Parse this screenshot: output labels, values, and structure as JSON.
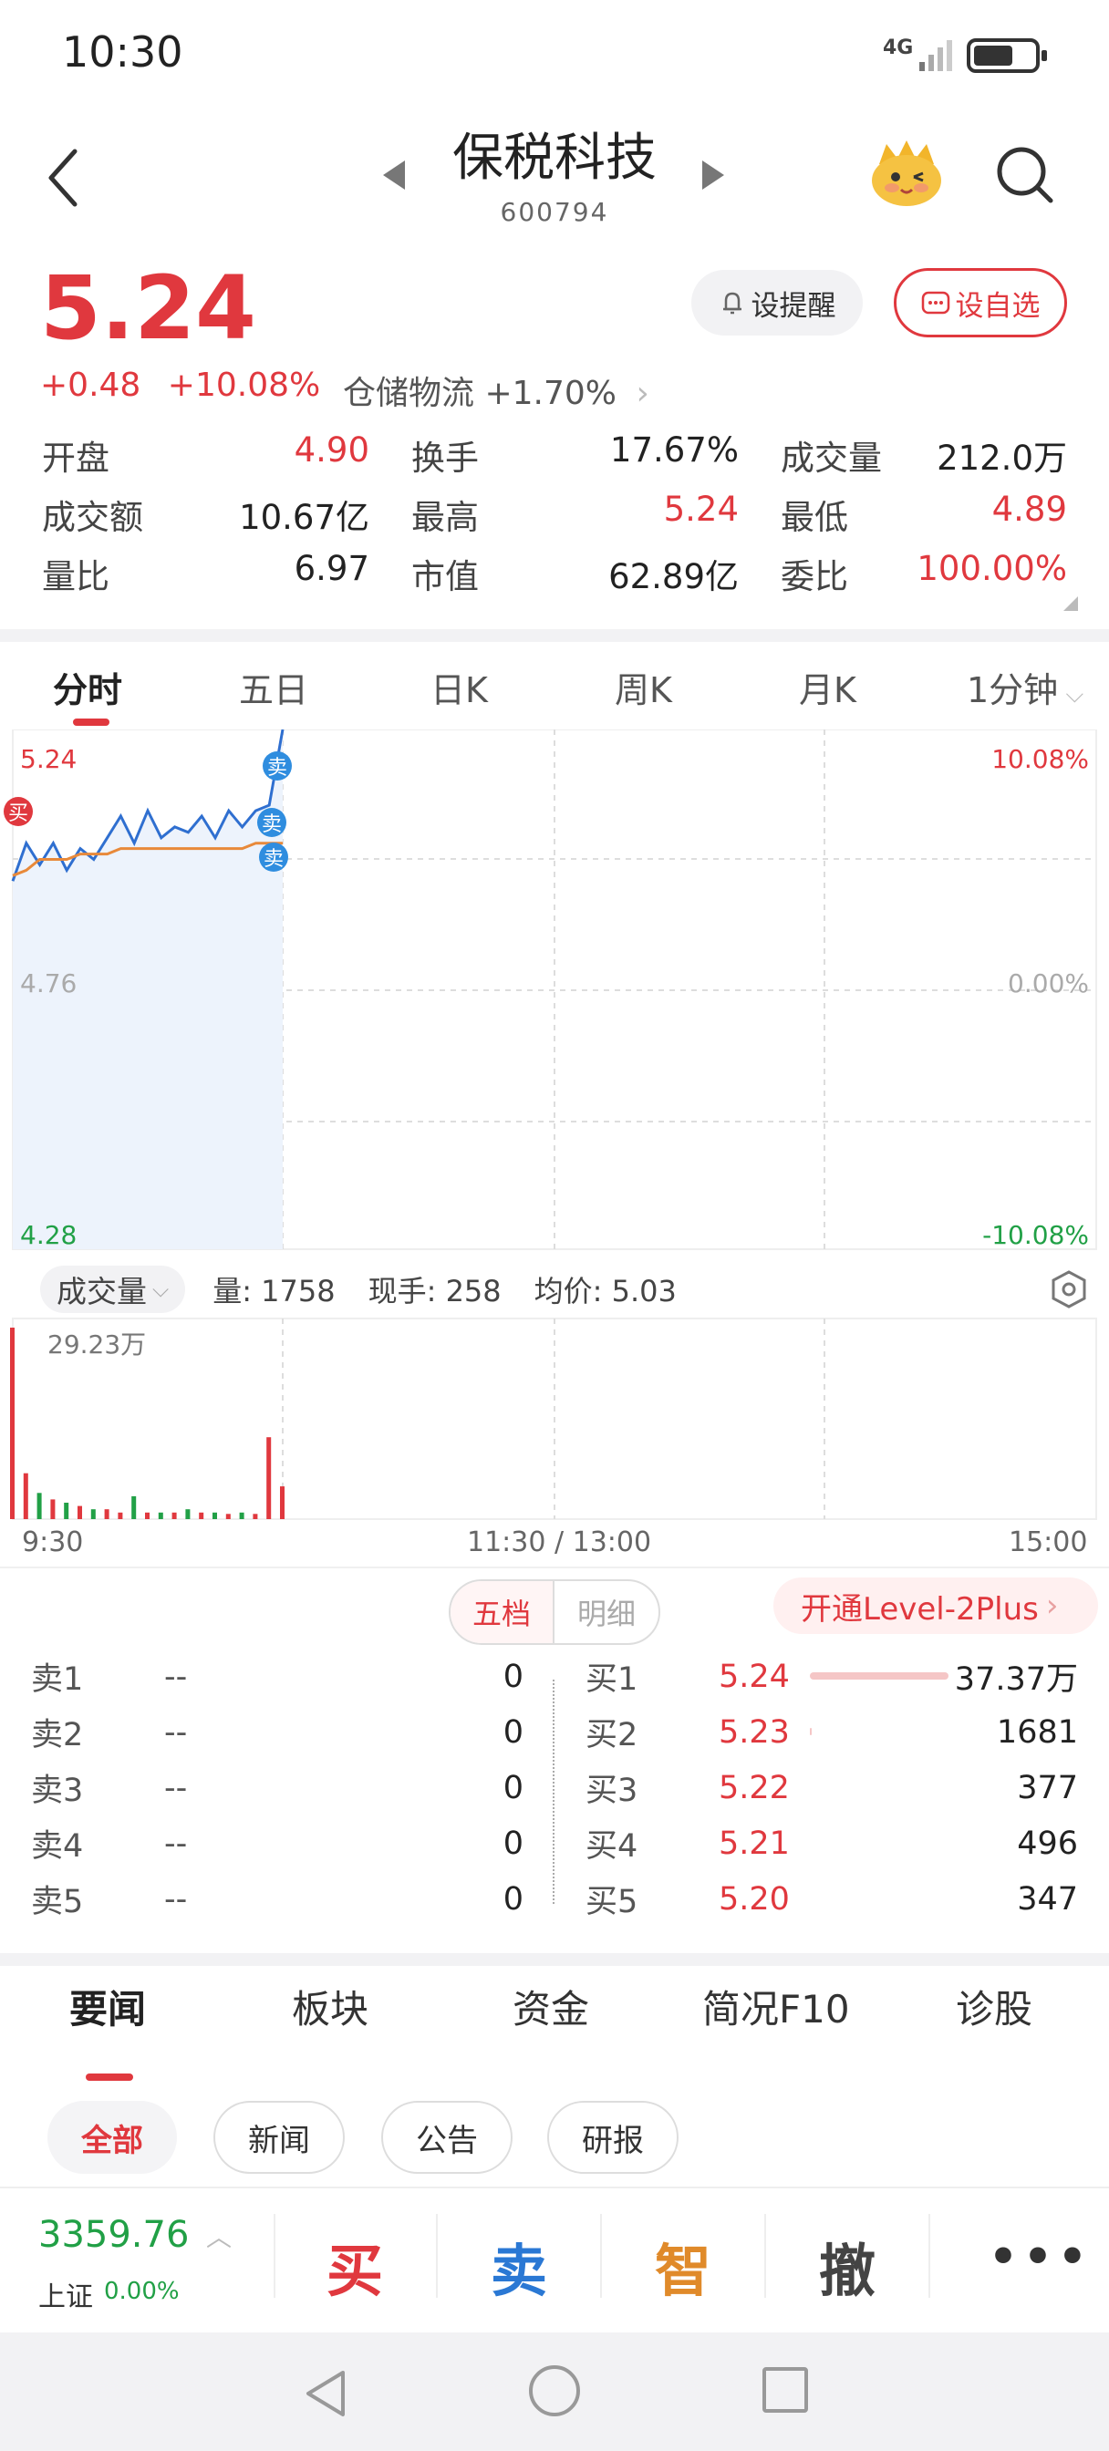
{
  "status_bar": {
    "time": "10:30",
    "network": "4G"
  },
  "header": {
    "title": "保税科技",
    "code": "600794"
  },
  "quote": {
    "price": "5.24",
    "change": "+0.48",
    "change_pct": "+10.08%",
    "sector_name": "仓储物流",
    "sector_change": "+1.70%",
    "remind_label": "设提醒",
    "watchlist_label": "设自选"
  },
  "stats": [
    [
      {
        "label": "开盘",
        "value": "4.90",
        "color": "red"
      },
      {
        "label": "换手",
        "value": "17.67%",
        "color": "black"
      },
      {
        "label": "成交量",
        "value": "212.0万",
        "color": "black"
      }
    ],
    [
      {
        "label": "成交额",
        "value": "10.67亿",
        "color": "black"
      },
      {
        "label": "最高",
        "value": "5.24",
        "color": "red"
      },
      {
        "label": "最低",
        "value": "4.89",
        "color": "red"
      }
    ],
    [
      {
        "label": "量比",
        "value": "6.97",
        "color": "black"
      },
      {
        "label": "市值",
        "value": "62.89亿",
        "color": "black"
      },
      {
        "label": "委比",
        "value": "100.00%",
        "color": "red"
      }
    ]
  ],
  "chart_tabs": [
    "分时",
    "五日",
    "日K",
    "周K",
    "月K",
    "1分钟"
  ],
  "chart_tabs_active": "分时",
  "chart": {
    "top_price": "5.24",
    "mid_price": "4.76",
    "bottom_price": "4.28",
    "top_pct": "10.08%",
    "mid_pct": "0.00%",
    "bottom_pct": "-10.08%",
    "buy_marker": "买",
    "sell_marker": "卖",
    "time_start": "9:30",
    "time_mid": "11:30 / 13:00",
    "time_end": "15:00"
  },
  "chart_data": {
    "type": "line",
    "x": [
      "9:30",
      "9:33",
      "9:36",
      "9:39",
      "9:42",
      "9:45",
      "9:48",
      "9:51",
      "9:54",
      "9:57",
      "10:00",
      "10:03",
      "10:06",
      "10:09",
      "10:12",
      "10:15",
      "10:18",
      "10:21",
      "10:24",
      "10:27",
      "10:30"
    ],
    "series": [
      {
        "values": [
          4.96,
          5.03,
          4.99,
          5.03,
          4.98,
          5.02,
          5.0,
          5.04,
          5.08,
          5.03,
          5.09,
          5.04,
          5.06,
          5.05,
          5.08,
          5.04,
          5.09,
          5.06,
          5.09,
          5.1,
          5.24
        ]
      },
      {
        "values": [
          4.97,
          4.98,
          5.0,
          5.0,
          5.0,
          5.01,
          5.01,
          5.01,
          5.02,
          5.02,
          5.02,
          5.02,
          5.02,
          5.02,
          5.02,
          5.02,
          5.02,
          5.02,
          5.03,
          5.03,
          5.03
        ]
      }
    ],
    "ylim": [
      4.28,
      5.24
    ],
    "volume": [
      29.23,
      7,
      4,
      3,
      2.5,
      2,
      1.5,
      1.5,
      1,
      3.5,
      1,
      1,
      1,
      1.5,
      1,
      1,
      0.8,
      1,
      0.8,
      12.5,
      5
    ],
    "volume_unit": "万"
  },
  "volume_bar": {
    "selector_label": "成交量",
    "volume": "量: 1758",
    "current_hand": "现手: 258",
    "avg_price": "均价: 5.03",
    "max_label": "29.23万"
  },
  "order_book": {
    "toggle_on": "五档",
    "toggle_off": "明细",
    "level2_label": "开通Level-2Plus",
    "asks": [
      {
        "name": "卖1",
        "price": "--",
        "volume": "0"
      },
      {
        "name": "卖2",
        "price": "--",
        "volume": "0"
      },
      {
        "name": "卖3",
        "price": "--",
        "volume": "0"
      },
      {
        "name": "卖4",
        "price": "--",
        "volume": "0"
      },
      {
        "name": "卖5",
        "price": "--",
        "volume": "0"
      }
    ],
    "bids": [
      {
        "name": "买1",
        "price": "5.24",
        "volume": "37.37万",
        "fill": 0.95
      },
      {
        "name": "买2",
        "price": "5.23",
        "volume": "1681",
        "fill": 0.01
      },
      {
        "name": "买3",
        "price": "5.22",
        "volume": "377",
        "fill": 0
      },
      {
        "name": "买4",
        "price": "5.21",
        "volume": "496",
        "fill": 0
      },
      {
        "name": "买5",
        "price": "5.20",
        "volume": "347",
        "fill": 0
      }
    ]
  },
  "news_tabs": [
    "要闻",
    "板块",
    "资金",
    "简况F10",
    "诊股"
  ],
  "news_filters": [
    "全部",
    "新闻",
    "公告",
    "研报"
  ],
  "index": {
    "value": "3359.76",
    "name": "上证",
    "pct": "0.00%"
  },
  "trade_buttons": [
    {
      "label": "买",
      "color": "#e0383e"
    },
    {
      "label": "卖",
      "color": "#2a78d4"
    },
    {
      "label": "智",
      "color": "#e08a2a"
    },
    {
      "label": "撤",
      "color": "#444"
    }
  ],
  "colors": {
    "up": "#e0383e",
    "down": "#21a046",
    "price_line": "#2f6fd0",
    "avg_line": "#e8893a"
  }
}
